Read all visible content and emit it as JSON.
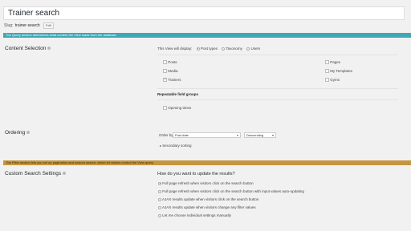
{
  "title": {
    "value": "Trainer search"
  },
  "slug": {
    "label": "Slug:",
    "value": "trainer-search",
    "edit": "Edit"
  },
  "query_bar": "The Query section determines what content the View loads from the database",
  "content_selection": {
    "label": "Content Selection",
    "display_text": "This View will display:",
    "display_options": [
      {
        "label": "Post types",
        "selected": true
      },
      {
        "label": "Taxonomy",
        "selected": false
      },
      {
        "label": "Users",
        "selected": false
      }
    ],
    "post_types_left": [
      {
        "label": "Posts",
        "checked": false
      },
      {
        "label": "Media",
        "checked": false
      },
      {
        "label": "Trainers",
        "checked": true
      }
    ],
    "post_types_right": [
      {
        "label": "Pages",
        "checked": false
      },
      {
        "label": "My Templates",
        "checked": false
      },
      {
        "label": "Gyms",
        "checked": false
      }
    ],
    "rfg_title": "Repeatable field groups",
    "rfg_items": [
      {
        "label": "Opening times",
        "checked": false
      }
    ]
  },
  "ordering": {
    "label": "Ordering",
    "order_by_label": "Order by",
    "order_by_value": "Post date",
    "direction_value": "Descending",
    "secondary": "Secondary sorting"
  },
  "filter_bar": "The Filter section lets you set up pagination and custom search, which let visitors control the View query",
  "custom_search": {
    "label": "Custom Search Settings",
    "question": "How do you want to update the results?",
    "options": [
      {
        "label": "Full page refresh when visitors click on the search button",
        "selected": true
      },
      {
        "label": "Full page refresh when visitors click on the search button with input values auto-updating",
        "selected": false
      },
      {
        "label": "AJAX results update when visitors click on the search button",
        "selected": false
      },
      {
        "label": "AJAX results update when visitors change any filter values",
        "selected": false
      },
      {
        "label": "Let me choose individual settings manually",
        "selected": false
      }
    ]
  }
}
